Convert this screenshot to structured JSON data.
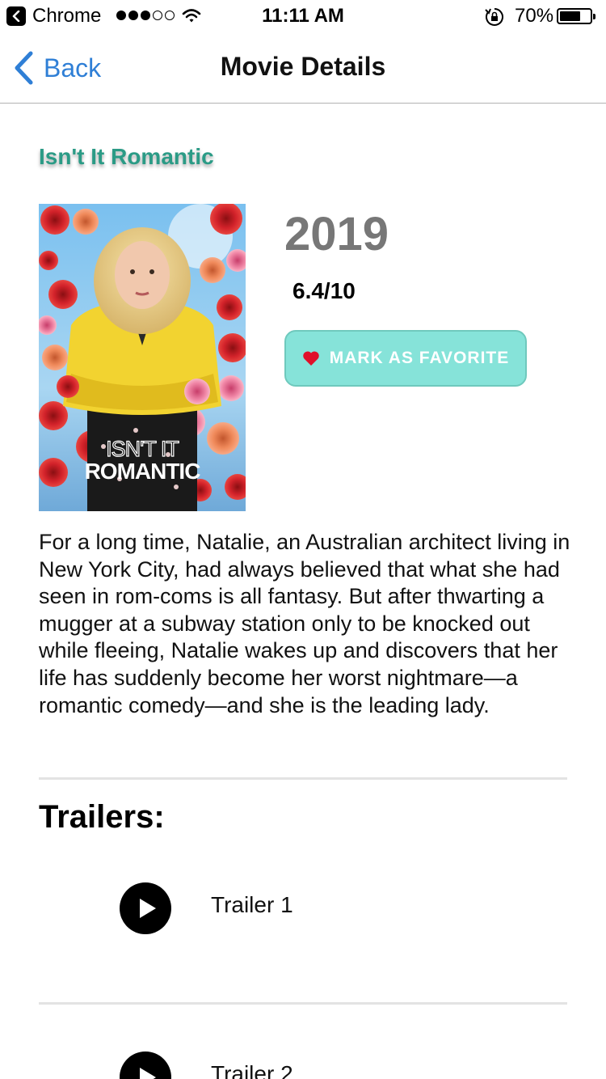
{
  "status_bar": {
    "app_name": "Chrome",
    "time": "11:11 AM",
    "battery": "70%",
    "battery_level": 0.7,
    "signal_bars_filled": 3,
    "signal_bars_total": 5
  },
  "nav": {
    "back_label": "Back",
    "title": "Movie Details",
    "accent_color": "#2f7fd6"
  },
  "movie": {
    "title": "Isn't It Romantic",
    "year": "2019",
    "rating": "6.4/10",
    "poster_text_line1": "ISN'T IT",
    "poster_text_line2": "ROMANTIC",
    "favorite_label": "MARK AS FAVORITE",
    "overview": "For a long time, Natalie, an Australian architect living in New York City, had always believed that what she had seen in rom-coms is all fantasy. But after thwarting a mugger at a subway station only to be knocked out while fleeing, Natalie wakes up and discovers that her life has suddenly become her worst nightmare—a romantic comedy—and she is the leading lady."
  },
  "trailers": {
    "heading": "Trailers:",
    "items": [
      {
        "label": "Trailer 1"
      },
      {
        "label": "Trailer 2"
      }
    ]
  },
  "colors": {
    "title_color": "#2b9b86",
    "favorite_button_bg": "#86e3d9",
    "heart_color": "#e0102a",
    "year_color": "#777777"
  },
  "icons": {
    "status_back": "back-to-app-icon",
    "wifi": "wifi-icon",
    "orientation_lock": "orientation-lock-icon",
    "battery": "battery-icon",
    "nav_back": "chevron-left-icon",
    "favorite": "heart-icon",
    "play": "play-icon"
  }
}
